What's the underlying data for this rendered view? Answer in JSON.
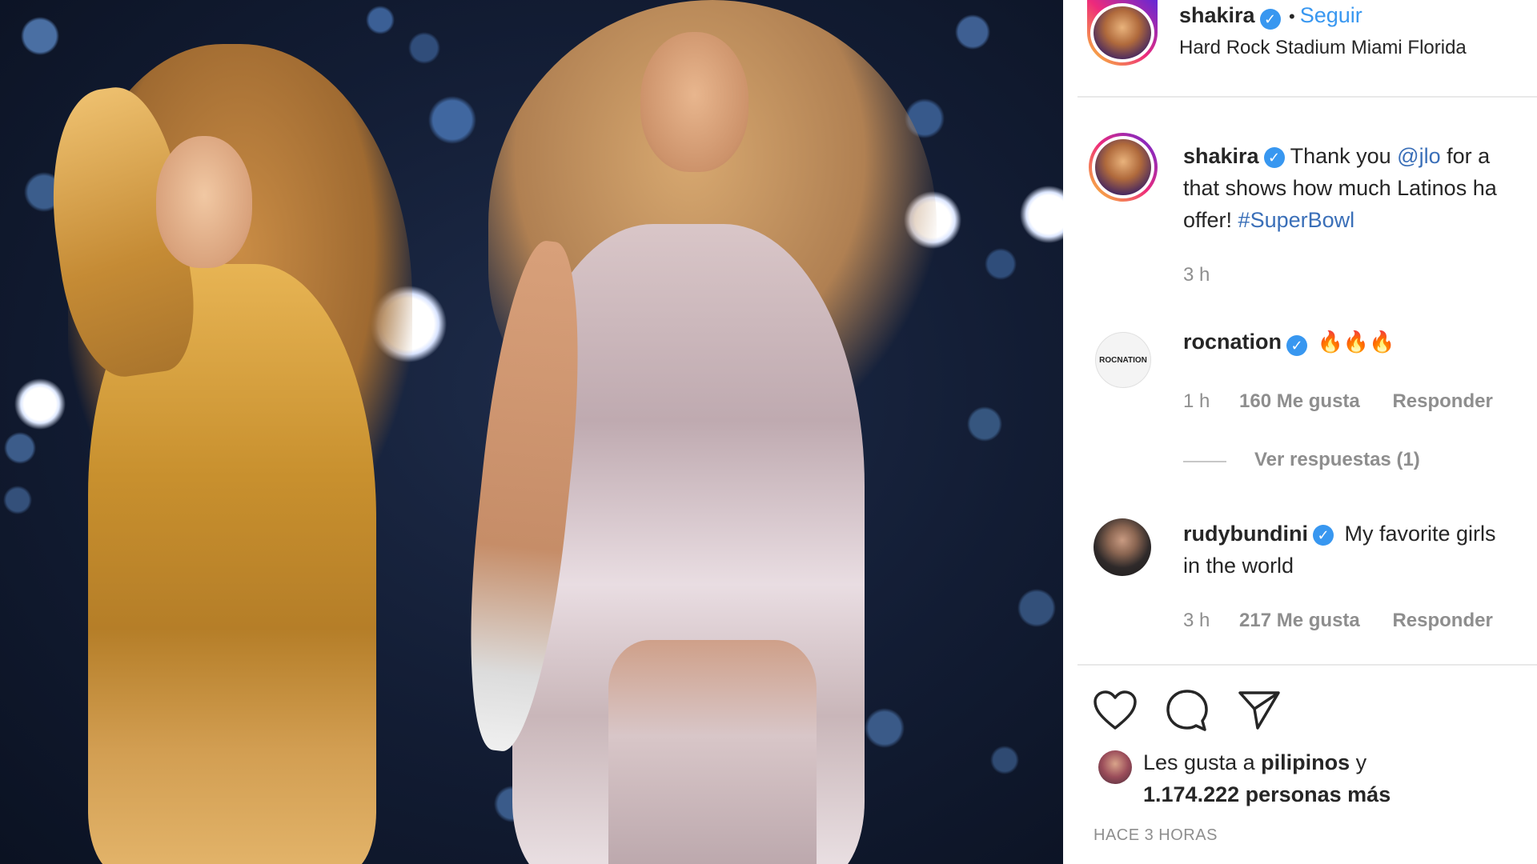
{
  "post": {
    "username": "shakira",
    "follow_dot": "•",
    "follow_label": "Seguir",
    "location": "Hard Rock Stadium Miami Florida"
  },
  "caption": {
    "username": "shakira",
    "text_before_mention": "Thank you ",
    "mention": "@jlo",
    "text_line1_rest": " for a",
    "text_line2": "that shows how much Latinos ha",
    "text_line3_start": "offer! ",
    "hashtag": "#SuperBowl",
    "time": "3 h"
  },
  "comments": [
    {
      "username": "rocnation",
      "logo_text": "ROCNATION",
      "text": "🔥🔥🔥",
      "time": "1 h",
      "likes": "160 Me gusta",
      "reply_label": "Responder",
      "view_replies": "Ver respuestas (1)"
    },
    {
      "username": "rudybundini",
      "text_line1": "My favorite girls",
      "text_line2": "in the world",
      "time": "3 h",
      "likes": "217 Me gusta",
      "reply_label": "Responder"
    }
  ],
  "actions": {
    "like_icon": "heart-outline-icon",
    "comment_icon": "speech-bubble-icon",
    "share_icon": "paper-plane-icon"
  },
  "likes": {
    "prefix": "Les gusta a ",
    "user": "pilipinos",
    "conjunction": " y",
    "others": "1.174.222 personas más"
  },
  "timestamp": "HACE 3 HORAS",
  "colors": {
    "link": "#3a6fb8",
    "follow": "#3897f0",
    "verified": "#3897f0",
    "muted": "#8e8e8e"
  }
}
